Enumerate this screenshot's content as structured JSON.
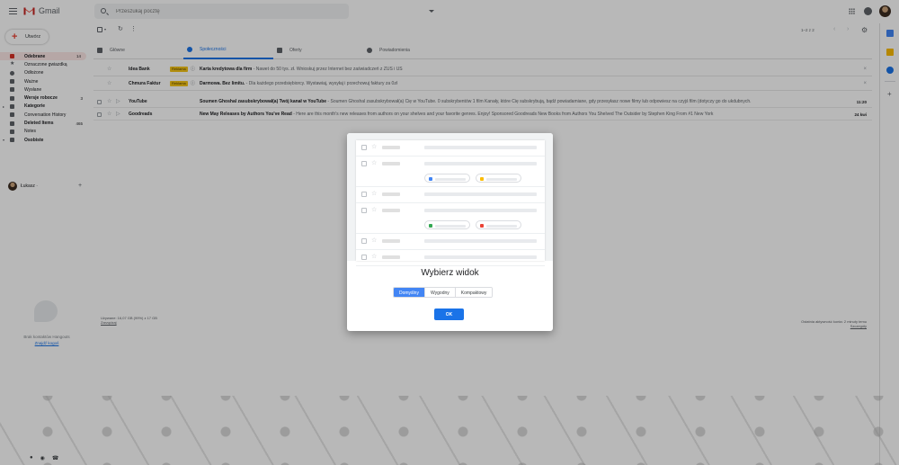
{
  "header": {
    "app_name": "Gmail",
    "search_placeholder": "Przeszukaj pocztę"
  },
  "sidebar": {
    "compose_label": "Utwórz",
    "items": [
      {
        "label": "Odebrane",
        "count": "14",
        "icon": "inbox-icon",
        "active": true,
        "bold": true
      },
      {
        "label": "Oznaczone gwiazdką",
        "count": "",
        "icon": "star-icon"
      },
      {
        "label": "Odłożone",
        "count": "",
        "icon": "clock-icon"
      },
      {
        "label": "Ważne",
        "count": "",
        "icon": "important-icon"
      },
      {
        "label": "Wysłane",
        "count": "",
        "icon": "send-icon"
      },
      {
        "label": "Wersje robocze",
        "count": "3",
        "icon": "draft-icon",
        "bold": true
      },
      {
        "label": "Kategorie",
        "count": "",
        "icon": "label-icon",
        "bold": true,
        "caret": "▸"
      },
      {
        "label": "Conversation History",
        "count": "",
        "icon": "label-icon"
      },
      {
        "label": "Deleted Items",
        "count": "465",
        "icon": "label-icon",
        "bold": true
      },
      {
        "label": "Notes",
        "count": "",
        "icon": "label-icon"
      },
      {
        "label": "Osobiste",
        "count": "",
        "icon": "label-icon",
        "bold": true,
        "caret": "▾"
      }
    ],
    "hangouts_user": "Łukasz ·",
    "no_contacts": "Brak kontaktów Hangouts",
    "find_someone": "Znajdź kogoś"
  },
  "toolbar": {
    "pager": "1–2 z 2"
  },
  "tabs": [
    {
      "label": "Główne",
      "active": false
    },
    {
      "label": "Społeczności",
      "active": true
    },
    {
      "label": "Oferty",
      "active": false
    },
    {
      "label": "Powiadomienia",
      "active": false
    }
  ],
  "promos": [
    {
      "sender": "Idea Bank",
      "badge": "Reklama",
      "subject": "Karta kredytowa dla firm",
      "snippet": " - Nawet do 50 tys. zł. Wnioskuj przez Internet bez zaświadczeń z ZUS i US"
    },
    {
      "sender": "Chmura Faktur",
      "badge": "Reklama",
      "subject": "Darmowa. Bez limitu.",
      "snippet": " - Dla każdego przedsiębiorcy. Wystawiaj, wysyłaj i przechowuj faktury za 0zł"
    }
  ],
  "emails": [
    {
      "sender": "YouTube",
      "subject": "Soumen Ghoshal zasubskrybował(a) Twój kanał w YouTube",
      "snippet": " - Soumen Ghoshal zasubskrybował(a) Cię w YouTube. 0 subskrybentów 1 film Kanały, które Cię subskrybują, bądź powiadamiane, gdy przesyłasz nowe filmy lub odpowiesz na czyjś film (dotyczy go do ukdubnych.",
      "date": "11:20"
    },
    {
      "sender": "Goodreads",
      "subject": "New May Releases by Authors You've Read",
      "snippet": " - Here are this month's new releases from authors on your shelves and your favorite genres. Enjoy! Sponsored Goodreads New Books from Authors You Shelved The Outsider by Stephen King From #1 New York",
      "date": "24 kwi"
    }
  ],
  "footer": {
    "storage_line": "Używane: 16,07 GB (99%) z 17 GB",
    "storage_link": "Zarządzaj",
    "activity_line": "Ostatnia aktywność konta: 2 minuty temu",
    "activity_link": "Szczegóły"
  },
  "dialog": {
    "title": "Wybierz widok",
    "options": [
      {
        "label": "Domyślny",
        "selected": true
      },
      {
        "label": "Wygodny",
        "selected": false
      },
      {
        "label": "Kompaktowy",
        "selected": false
      }
    ],
    "ok_label": "OK"
  },
  "colors": {
    "accent": "#1a73e8",
    "selected_option": "#4285f4",
    "active_nav_bg": "#fce8e6",
    "badge": "#f5c518"
  }
}
